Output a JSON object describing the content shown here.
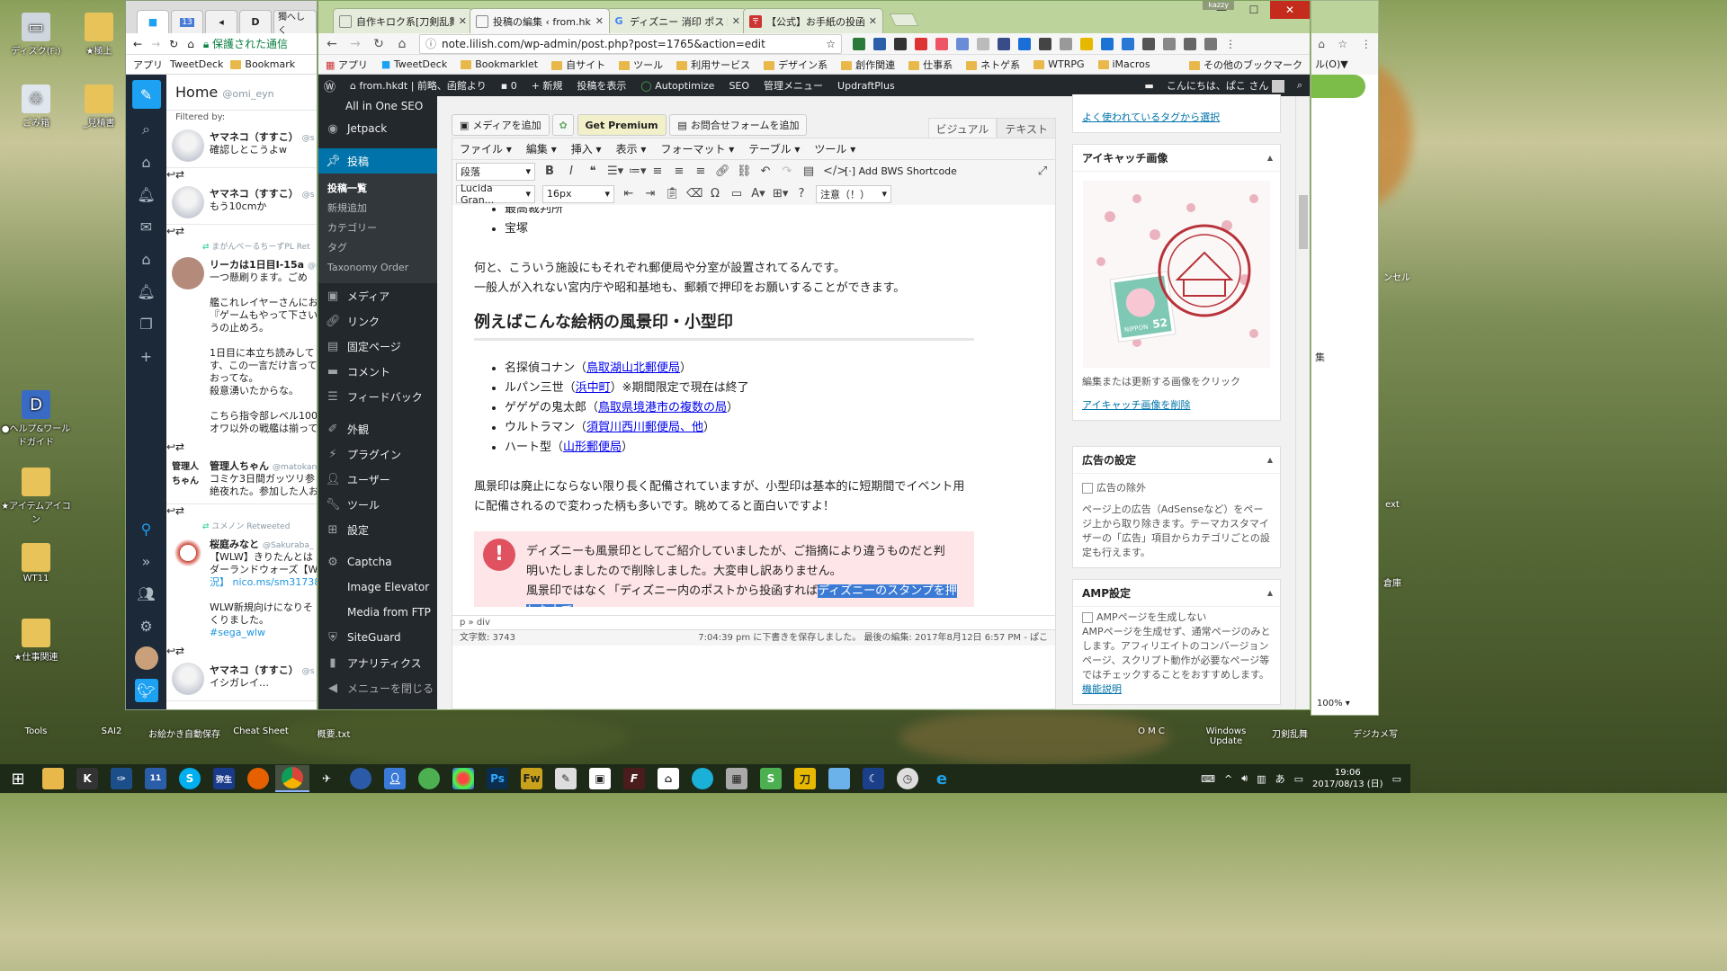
{
  "desktop": {
    "left_icons": [
      {
        "label": "ディスク(F:)",
        "icon": "drive-icon"
      },
      {
        "label": "★極上",
        "icon": "folder-icon"
      },
      {
        "label": "ごみ箱",
        "icon": "recycle-bin-icon"
      },
      {
        "label": "_見積書",
        "icon": "folder-icon"
      },
      {
        "label": "●ヘルプ&ワールドガイド",
        "icon": "help-icon"
      },
      {
        "label": "★アイテムアイコン",
        "icon": "folder-icon"
      },
      {
        "label": "WT11",
        "icon": "folder-icon"
      },
      {
        "label": "★仕事関連",
        "icon": "folder-icon"
      }
    ],
    "bottom_icons": [
      "Tools",
      "SAI2",
      "お絵かき自動保存",
      "Cheat Sheet",
      "概要.txt"
    ],
    "right_icons": [
      "O M C",
      "Windows Update",
      "刀剣乱舞",
      "デジカメ写"
    ],
    "right_edge_labels": [
      "ンセル",
      "ext",
      "倉庫"
    ]
  },
  "tweetdeck": {
    "tabs": [
      "",
      "13",
      "",
      "",
      "獨へしく"
    ],
    "url_secure": "保護された通信",
    "bookmarks": [
      "アプリ",
      "TweetDeck",
      "Bookmark"
    ],
    "column_title": "Home",
    "column_handle": "@omi_eyn",
    "filtered_by": "Filtered by:",
    "tweets": [
      {
        "name": "ヤマネコ（すすこ）",
        "handle": "@s",
        "lines": [
          "確認しとこうよw"
        ]
      },
      {
        "name": "ヤマネコ（すすこ）",
        "handle": "@s",
        "lines": [
          "もう10cmか"
        ]
      },
      {
        "retweet": "まがんべーるちーずPL Ret",
        "name": "リーカは1日目I-15a",
        "handle": "@r",
        "lines": [
          "一つ懸刷ります。ごめ",
          "",
          "艦これレイヤーさんにお",
          "『ゲームもやって下さい",
          "うの止めろ。",
          "",
          "1日目に本立ち読みして",
          "す、この一言だけ言って",
          "おってな。",
          "殺意湧いたからな。",
          "",
          "こちら指令部レベル100",
          "オワ以外の戦艦は揃って"
        ]
      },
      {
        "name": "管理人ちゃん",
        "handle": "@matokan",
        "lines": [
          "コミケ3日間ガッツリ参",
          "絶夜れた。参加した人お"
        ]
      },
      {
        "retweet": "ユメノン Retweeted",
        "name": "桜庭みなと",
        "handle": "@Sakuraba_",
        "lines": [
          "【WLW】きりたんとは",
          "ダーランドウォーズ【W",
          "況】 nico.ms/sm317384",
          "",
          "WLW新規向けになりそ",
          "くりました。",
          "#sega_wlw"
        ]
      },
      {
        "name": "ヤマネコ（すすこ）",
        "handle": "@s",
        "lines": [
          "イシガレイ…"
        ]
      }
    ]
  },
  "chrome": {
    "user": "kazzy",
    "tabs": [
      {
        "title": "自作キロク系[刀剣乱舞] 相",
        "active": false
      },
      {
        "title": "投稿の編集 ‹ from.hkdt",
        "active": true
      },
      {
        "title": "ディズニー 消印 ポスト - Go",
        "active": false
      },
      {
        "title": "【公式】お手紙の投函｜便",
        "active": false
      }
    ],
    "url": "note.lilish.com/wp-admin/post.php?post=1765&action=edit",
    "bookmarks": [
      "アプリ",
      "TweetDeck",
      "Bookmarklet",
      "自サイト",
      "ツール",
      "利用サービス",
      "デザイン系",
      "創作関連",
      "仕事系",
      "ネトゲ系",
      "WTRPG",
      "iMacros",
      "その他のブックマーク"
    ]
  },
  "wp": {
    "adminbar": {
      "site": "from.hkdt | 前略、函館より",
      "comments": "0",
      "new": "新規",
      "view": "投稿を表示",
      "autoptimize": "Autoptimize",
      "seo": "SEO",
      "admin_menu": "管理メニュー",
      "updraft": "UpdraftPlus",
      "greeting": "こんにちは、ぱこ さん"
    },
    "menu": {
      "top_items": [
        "All in One SEO",
        "Jetpack"
      ],
      "posts": "投稿",
      "posts_sub": [
        "投稿一覧",
        "新規追加",
        "カテゴリー",
        "タグ",
        "Taxonomy Order"
      ],
      "items": [
        "メディア",
        "リンク",
        "固定ページ",
        "コメント",
        "フィードバック",
        "外観",
        "プラグイン",
        "ユーザー",
        "ツール",
        "設定",
        "Captcha",
        "Image Elevator",
        "Media from FTP",
        "SiteGuard",
        "アナリティクス",
        "メニューを閉じる"
      ]
    },
    "editor": {
      "add_media": "メディアを追加",
      "get_premium": "Get Premium",
      "add_form": "お問合せフォームを追加",
      "visual": "ビジュアル",
      "text": "テキスト",
      "menubar": [
        "ファイル",
        "編集",
        "挿入",
        "表示",
        "フォーマット",
        "テーブル",
        "ツール"
      ],
      "format_select": "段落",
      "bws_shortcode": "Add BWS Shortcode",
      "font_select": "Lucida Gran...",
      "size_select": "16px",
      "notice_select": "注意（！）",
      "list_top": [
        "最高裁判所",
        "宝塚"
      ],
      "para1_line1": "何と、こういう施設にもそれぞれ郵便局や分室が設置されてるんです。",
      "para1_line2": "一般人が入れない宮内庁や昭和基地も、郵頼で押印をお願いすることができます。",
      "heading": "例えばこんな絵柄の風景印・小型印",
      "list2": [
        {
          "name": "名探偵コナン（",
          "link": "鳥取湖山北郵便局",
          "after": "）"
        },
        {
          "name": "ルパン三世（",
          "link": "浜中町",
          "after": "）※期間限定で現在は終了"
        },
        {
          "name": "ゲゲゲの鬼太郎（",
          "link": "鳥取県境港市の複数の局",
          "after": "）"
        },
        {
          "name": "ウルトラマン（",
          "link": "須賀川西川郵便局、他",
          "after": "）"
        },
        {
          "name": "ハート型（",
          "link": "山形郵便局",
          "after": "）"
        }
      ],
      "para2_line1": "風景印は廃止にならない限り長く配備されていますが、小型印は基本的に短期間でイベント用",
      "para2_line2": "に配備されるので変わった柄も多いです。眺めてると面白いですよ！",
      "alert_line1": "ディズニーも風景印としてご紹介していましたが、ご指摘により違うものだと判",
      "alert_line2": "明いたしましたので削除しました。大変申し訳ありません。",
      "alert_line3": "風景印ではなく「ディズニー内のポストから投函すれば",
      "alert_selected": "ディズニーのスタンプを押した上で",
      "path": "p » div",
      "word_count": "文字数: 3743",
      "status": "7:04:39 pm に下書きを保存しました。 最後の編集: 2017年8月12日 6:57 PM - ぱこ"
    },
    "sidebar": {
      "tags_link": "よく使われているタグから選択",
      "featured_title": "アイキャッチ画像",
      "featured_hint": "編集または更新する画像をクリック",
      "featured_remove": "アイキャッチ画像を削除",
      "stamp_value": "52",
      "stamp_text": "NIPPON",
      "ads_title": "広告の設定",
      "ads_exclude": "広告の除外",
      "ads_desc": "ページ上の広告（AdSenseなど）をページ上から取り除きます。テーマカスタマイザーの「広告」項目からカテゴリごとの設定も行えます。",
      "amp_title": "AMP設定",
      "amp_opt": "AMPページを生成しない",
      "amp_desc": "AMPページを生成せず、通常ページのみとします。アフィリエイトのコンバージョンページ、スクリプト動作が必要なページ等ではチェックすることをおすすめします。",
      "amp_link": "機能説明"
    }
  },
  "right_window": {
    "menu": "ル(O)▼",
    "zoom": "100%",
    "label": "集"
  },
  "taskbar": {
    "apps": [
      "explorer",
      "k",
      "feather",
      "calendar",
      "S",
      "弥生17",
      "firefox",
      "chrome",
      "plane",
      "thunderbird",
      "person",
      "globe",
      "rgb",
      "Ps",
      "Fw",
      "note",
      "window",
      "F",
      "home",
      "ball",
      "calc",
      "S",
      "刀",
      "finder",
      "moon",
      "clock",
      "ie"
    ],
    "ime": "あ",
    "time": "19:06",
    "date": "2017/08/13 (日)"
  }
}
